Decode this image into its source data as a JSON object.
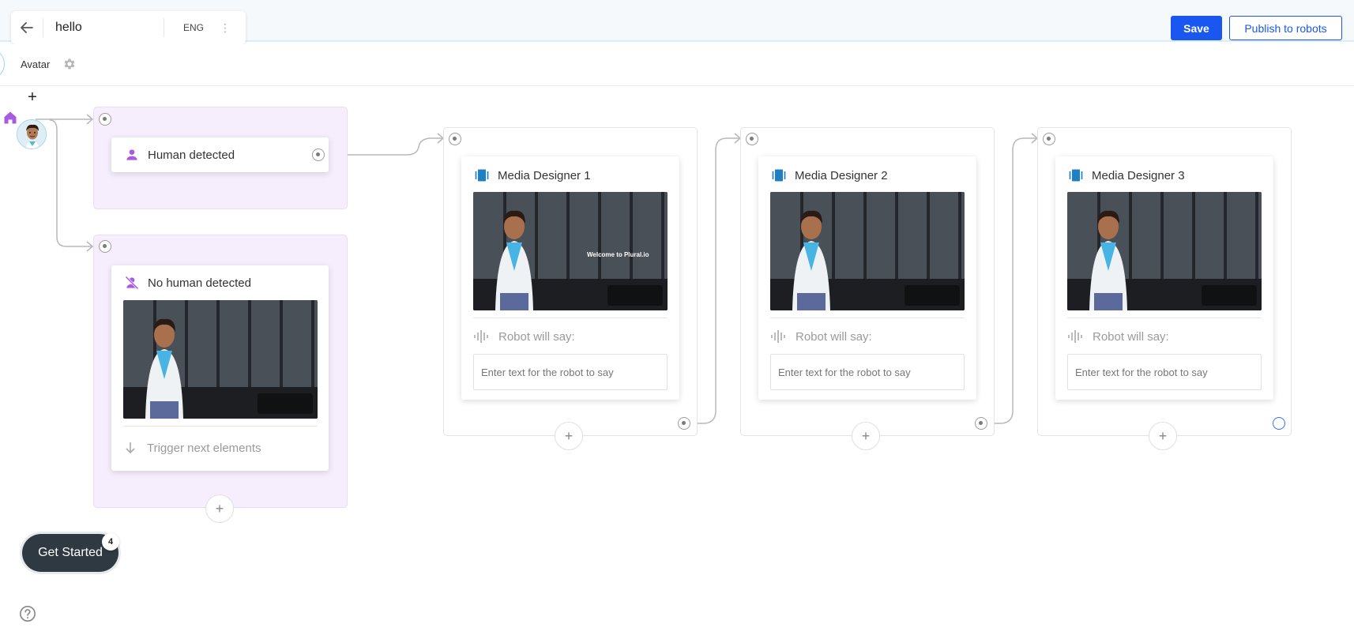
{
  "header": {
    "title": "hello",
    "language": "ENG",
    "save_label": "Save",
    "publish_label": "Publish to robots"
  },
  "subbar": {
    "avatar_label": "Avatar"
  },
  "flow": {
    "human_detected": {
      "title": "Human detected"
    },
    "no_human_detected": {
      "title": "No human detected",
      "trigger_label": "Trigger next elements"
    },
    "media_designers": [
      {
        "title": "Media Designer 1",
        "overlay_text": "Welcome to Plural.io",
        "say_label": "Robot will say:",
        "input_placeholder": "Enter text for the robot to say"
      },
      {
        "title": "Media Designer 2",
        "say_label": "Robot will say:",
        "input_placeholder": "Enter text for the robot to say"
      },
      {
        "title": "Media Designer 3",
        "say_label": "Robot will say:",
        "input_placeholder": "Enter text for the robot to say"
      }
    ]
  },
  "get_started": {
    "label": "Get Started",
    "badge": "4"
  },
  "colors": {
    "primary": "#1a56f0",
    "accent_purple": "#a95be0",
    "media_blue": "#1f7fc4",
    "group_bg": "#f6eefc"
  },
  "icons": {
    "back": "arrow-left-icon",
    "settings": "gear-icon",
    "home": "home-icon",
    "person": "person-icon",
    "person_off": "person-off-icon",
    "media": "media-designer-icon",
    "audio": "audio-wave-icon",
    "arrow_down": "arrow-down-icon",
    "help": "help-circle-icon"
  }
}
